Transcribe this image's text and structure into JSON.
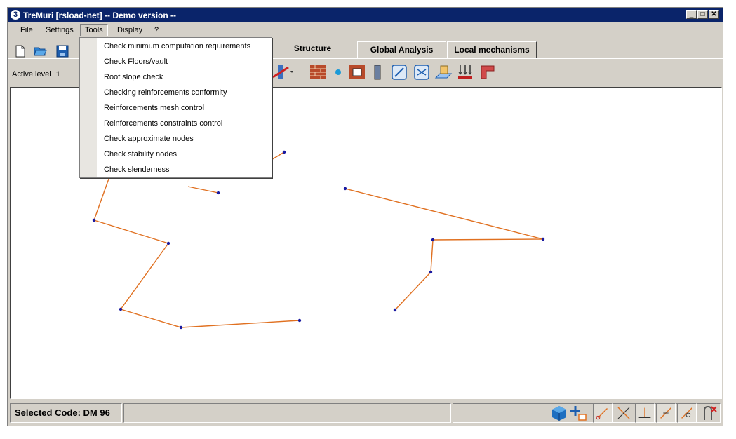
{
  "window": {
    "title": "TreMuri [rsload-net] -- Demo version --",
    "app_icon_glyph": "3",
    "controls": [
      "_",
      "□",
      "✕"
    ]
  },
  "menubar": {
    "items": [
      {
        "label": "File"
      },
      {
        "label": "Settings"
      },
      {
        "label": "Tools"
      },
      {
        "label": "Display"
      },
      {
        "label": "?"
      }
    ],
    "open_menu": "Tools"
  },
  "tools_menu": {
    "items": [
      "Check minimum computation requirements",
      "Check Floors/vault",
      "Roof slope check",
      "Checking reinforcements conformity",
      "Reinforcements mesh control",
      "Reinforcements constraints control",
      "Check approximate nodes",
      "Check stability nodes",
      "Check slenderness"
    ]
  },
  "tabs": [
    {
      "label": "Structure",
      "active": true
    },
    {
      "label": "Global Analysis",
      "active": false
    },
    {
      "label": "Local mechanisms",
      "active": false
    }
  ],
  "toolbar": {
    "active_level_label": "Active level",
    "active_level_value": "1",
    "icons": [
      "new-file-icon",
      "open-folder-icon",
      "save-icon",
      "wall-cut-icon",
      "brick-wall-icon",
      "node-dot-icon",
      "wall-opening-icon",
      "pillar-icon",
      "diagonal-element-icon",
      "floor-icon",
      "slab-icon",
      "loads-icon",
      "l-beam-icon"
    ]
  },
  "status": {
    "selected_code": "Selected Code: DM 96",
    "tool_icons": [
      "3d-view-icon",
      "add-element-icon",
      "snap-endpoint-icon",
      "snap-intersection-icon",
      "snap-perpendicular-icon",
      "snap-on-line-icon",
      "snap-nearest-icon",
      "remove-snap-icon"
    ]
  },
  "colors": {
    "titlebar": "#0a246a",
    "chrome": "#d4d0c8",
    "wall_line": "#e07020",
    "node": "#1a1aa0"
  },
  "canvas": {
    "walls": [
      [
        [
          -2,
          -1
        ],
        [
          3,
          1
        ]
      ],
      [
        [
          3,
          1
        ],
        [
          6,
          -3
        ]
      ]
    ]
  }
}
